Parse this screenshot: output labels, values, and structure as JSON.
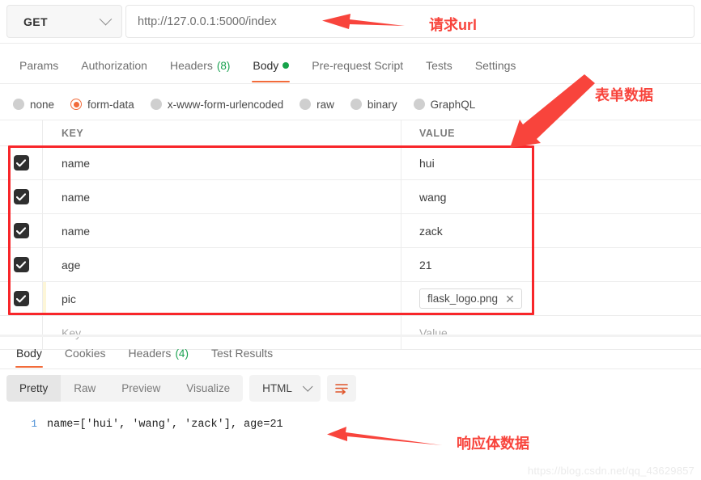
{
  "request": {
    "method": "GET",
    "url": "http://127.0.0.1:5000/index",
    "tabs": [
      {
        "label": "Params",
        "count": "",
        "dot": false,
        "active": false
      },
      {
        "label": "Authorization",
        "count": "",
        "dot": false,
        "active": false
      },
      {
        "label": "Headers",
        "count": "(8)",
        "dot": false,
        "active": false
      },
      {
        "label": "Body",
        "count": "",
        "dot": true,
        "active": true
      },
      {
        "label": "Pre-request Script",
        "count": "",
        "dot": false,
        "active": false
      },
      {
        "label": "Tests",
        "count": "",
        "dot": false,
        "active": false
      },
      {
        "label": "Settings",
        "count": "",
        "dot": false,
        "active": false
      }
    ],
    "body_types": [
      {
        "label": "none",
        "selected": false
      },
      {
        "label": "form-data",
        "selected": true
      },
      {
        "label": "x-www-form-urlencoded",
        "selected": false
      },
      {
        "label": "raw",
        "selected": false
      },
      {
        "label": "binary",
        "selected": false
      },
      {
        "label": "GraphQL",
        "selected": false
      }
    ],
    "table": {
      "headers": {
        "key": "KEY",
        "value": "VALUE"
      },
      "rows": [
        {
          "checked": true,
          "key": "name",
          "value": "hui",
          "is_file": false
        },
        {
          "checked": true,
          "key": "name",
          "value": "wang",
          "is_file": false
        },
        {
          "checked": true,
          "key": "name",
          "value": "zack",
          "is_file": false
        },
        {
          "checked": true,
          "key": "age",
          "value": "21",
          "is_file": false
        },
        {
          "checked": true,
          "key": "pic",
          "value": "flask_logo.png",
          "is_file": true
        }
      ],
      "placeholder_row": {
        "key": "Key",
        "value": "Value"
      }
    }
  },
  "response": {
    "tabs": [
      {
        "label": "Body",
        "count": "",
        "active": true
      },
      {
        "label": "Cookies",
        "count": "",
        "active": false
      },
      {
        "label": "Headers",
        "count": "(4)",
        "active": false
      },
      {
        "label": "Test Results",
        "count": "",
        "active": false
      }
    ],
    "view_modes": [
      {
        "label": "Pretty",
        "active": true
      },
      {
        "label": "Raw",
        "active": false
      },
      {
        "label": "Preview",
        "active": false
      },
      {
        "label": "Visualize",
        "active": false
      }
    ],
    "format": "HTML",
    "line_number": "1",
    "body_text": "name=['hui', 'wang', 'zack'], age=21"
  },
  "annotations": {
    "url_note": "请求url",
    "form_note": "表单数据",
    "response_note": "响应体数据"
  },
  "watermark": "https://blog.csdn.net/qq_43629857",
  "colors": {
    "accent": "#f26b3a",
    "annotation_red": "#f8443c",
    "box_red": "#f8262a",
    "green": "#1aa251",
    "line_number_blue": "#4b8fd6"
  }
}
